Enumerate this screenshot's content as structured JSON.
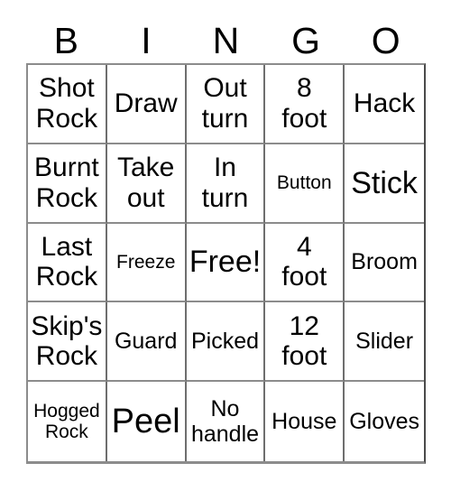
{
  "card": {
    "headers": [
      "B",
      "I",
      "N",
      "G",
      "O"
    ],
    "rows": [
      [
        {
          "label": "Shot\nRock",
          "size": "md"
        },
        {
          "label": "Draw",
          "size": "md"
        },
        {
          "label": "Out\nturn",
          "size": "md"
        },
        {
          "label": "8\nfoot",
          "size": "md"
        },
        {
          "label": "Hack",
          "size": "md"
        }
      ],
      [
        {
          "label": "Burnt\nRock",
          "size": "md"
        },
        {
          "label": "Take\nout",
          "size": "md"
        },
        {
          "label": "In\nturn",
          "size": "md"
        },
        {
          "label": "Button",
          "size": "xs"
        },
        {
          "label": "Stick",
          "size": "lg"
        }
      ],
      [
        {
          "label": "Last\nRock",
          "size": "md"
        },
        {
          "label": "Freeze",
          "size": "xs"
        },
        {
          "label": "Free!",
          "size": "lg"
        },
        {
          "label": "4\nfoot",
          "size": "md"
        },
        {
          "label": "Broom",
          "size": "sm"
        }
      ],
      [
        {
          "label": "Skip's\nRock",
          "size": "md"
        },
        {
          "label": "Guard",
          "size": "sm"
        },
        {
          "label": "Picked",
          "size": "sm"
        },
        {
          "label": "12\nfoot",
          "size": "md"
        },
        {
          "label": "Slider",
          "size": "sm"
        }
      ],
      [
        {
          "label": "Hogged\nRock",
          "size": "xs"
        },
        {
          "label": "Peel",
          "size": "xl"
        },
        {
          "label": "No\nhandle",
          "size": "sm"
        },
        {
          "label": "House",
          "size": "sm"
        },
        {
          "label": "Gloves",
          "size": "sm"
        }
      ]
    ],
    "colors": {
      "background": "#ffffff",
      "text": "#000000",
      "grid_line": "#8c8c8c",
      "grid_line_dark": "#4a4a4a"
    }
  }
}
